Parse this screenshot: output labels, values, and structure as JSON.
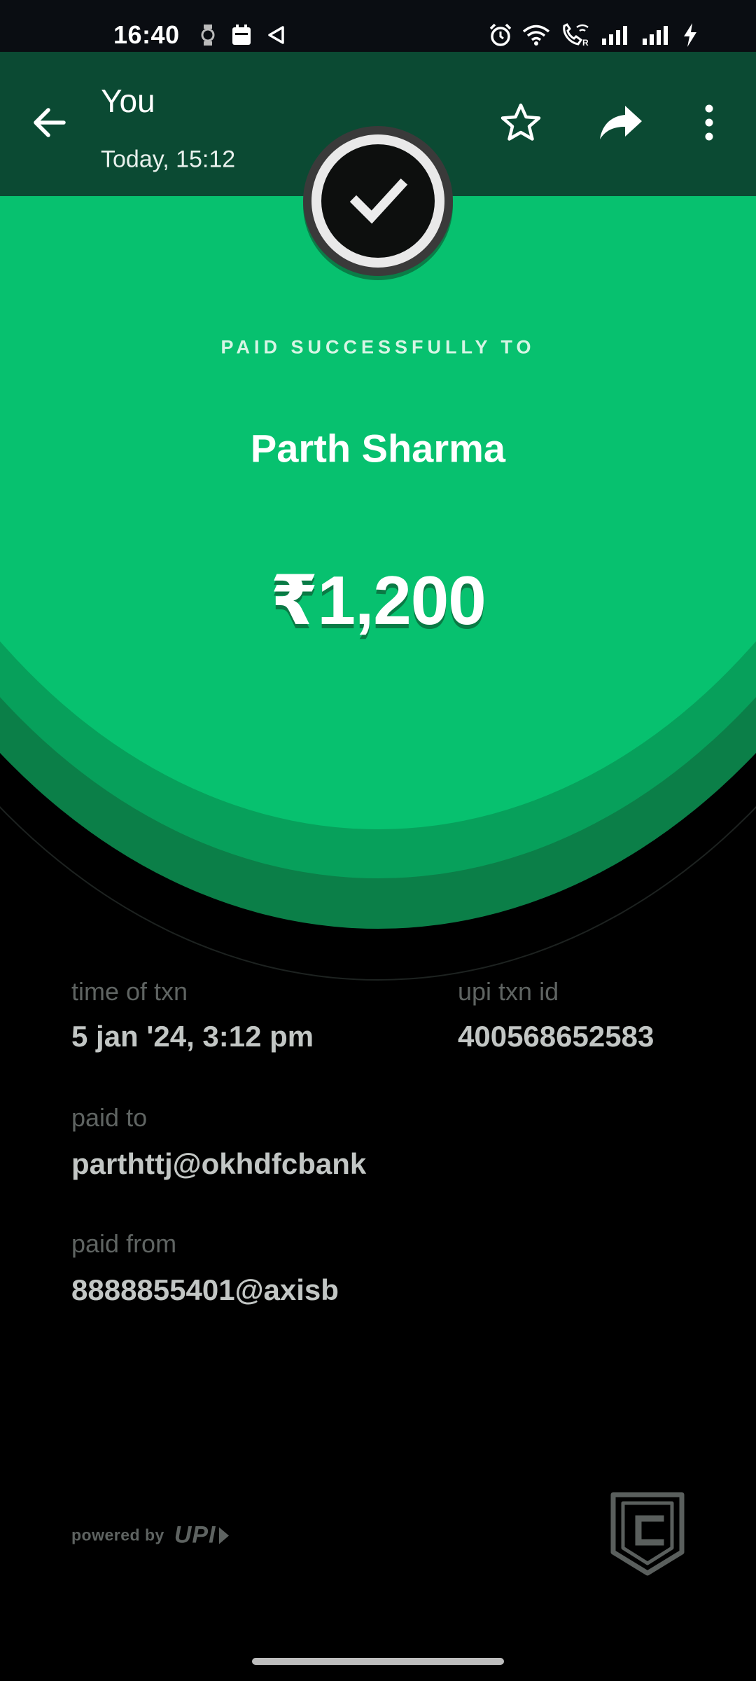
{
  "status_bar": {
    "time": "16:40",
    "left_icons": [
      "watch-icon",
      "calendar-icon",
      "navigation-icon"
    ],
    "right_icons": [
      "alarm-icon",
      "wifi-icon",
      "wifi-call-icon",
      "signal-icon",
      "signal-icon",
      "charging-icon"
    ]
  },
  "app_bar": {
    "title": "You",
    "subtitle": "Today, 15:12",
    "icons": [
      "back-arrow-icon",
      "star-icon",
      "share-icon",
      "more-vert-icon"
    ]
  },
  "receipt": {
    "status_label": "PAID SUCCESSFULLY TO",
    "payee_name": "Parth Sharma",
    "amount": "₹1,200",
    "status_icon": "check-icon",
    "colors": {
      "accent_green": "#07c16f",
      "mid_green": "#07a05b",
      "dark_green": "#0b7f48",
      "app_bar": "#0b4a33"
    },
    "details": {
      "time_label": "time of txn",
      "time_value": "5 jan '24, 3:12 pm",
      "txn_id_label": "upi txn id",
      "txn_id_value": "400568652583",
      "paid_to_label": "paid to",
      "paid_to_value": "parthttj@okhdfcbank",
      "paid_from_label": "paid from",
      "paid_from_value": "8888855401@axisb"
    },
    "footer": {
      "powered_by": "powered by",
      "upi_logo": "UPI",
      "brand_icon": "cred-crest-icon"
    }
  }
}
